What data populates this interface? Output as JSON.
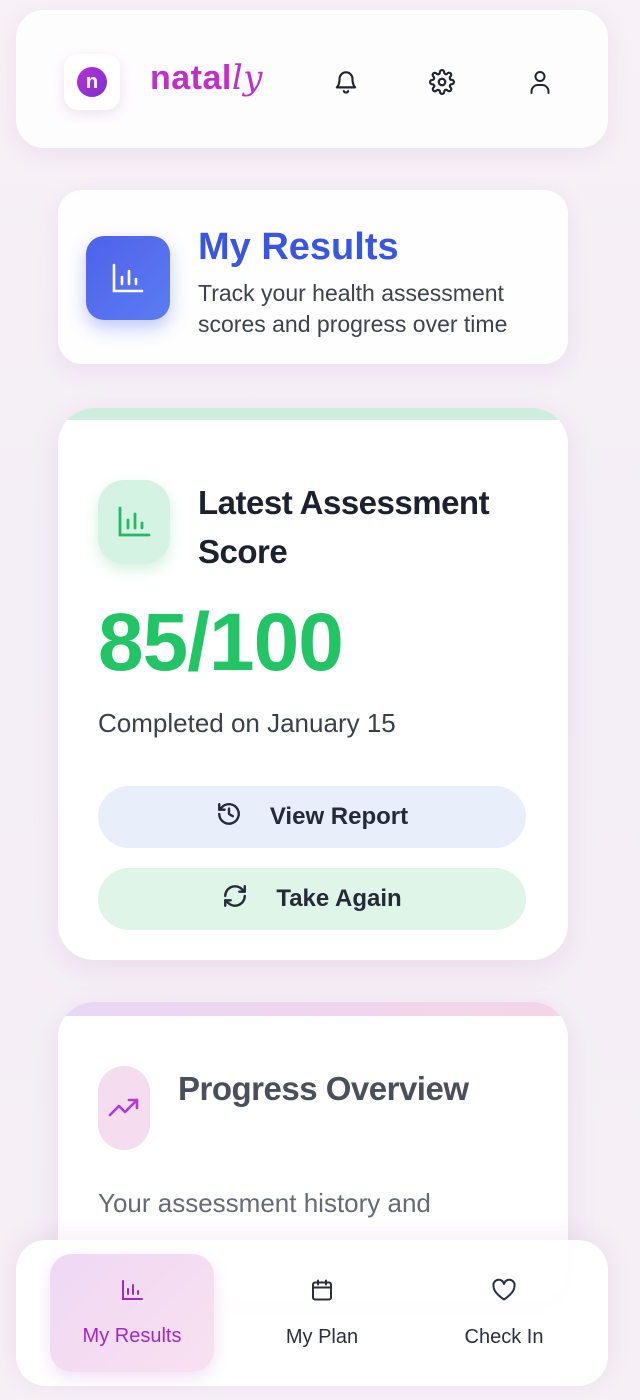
{
  "header": {
    "logo_letter": "n",
    "brand_main": "natal",
    "brand_accent": "ly",
    "icons": [
      "bell-icon",
      "gear-icon",
      "user-icon"
    ]
  },
  "results_header": {
    "title": "My Results",
    "subtitle": "Track your health assessment scores and progress over time",
    "icon": "bar-chart-icon"
  },
  "latest_score": {
    "title": "Latest Assessment Score",
    "score": "85/100",
    "completed": "Completed on January 15",
    "icon": "bar-chart-icon",
    "view_report_label": "View Report",
    "view_report_icon": "history-icon",
    "take_again_label": "Take Again",
    "take_again_icon": "refresh-icon"
  },
  "progress": {
    "title": "Progress Overview",
    "description": "Your assessment history and",
    "icon": "trending-up-icon"
  },
  "bottom_nav": {
    "items": [
      {
        "label": "My Results",
        "icon": "bar-chart-icon",
        "active": true
      },
      {
        "label": "My Plan",
        "icon": "calendar-icon",
        "active": false
      },
      {
        "label": "Check In",
        "icon": "heart-icon",
        "active": false
      }
    ]
  },
  "colors": {
    "brand": "#c02fc7",
    "title_blue": "#3a55e0",
    "score_green": "#23c465"
  }
}
